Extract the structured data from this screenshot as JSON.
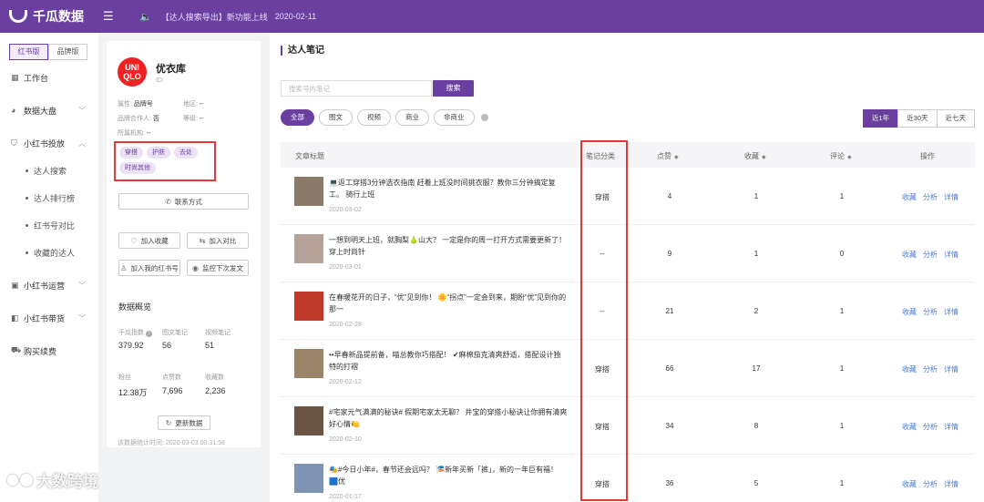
{
  "app": {
    "name": "千瓜数据",
    "notice": "【达人搜索导出】新功能上线",
    "notice_date": "2020-02-11"
  },
  "sidebar": {
    "version_tabs": [
      "红书版",
      "品牌版"
    ],
    "items": [
      {
        "label": "工作台"
      },
      {
        "label": "数据大盘"
      },
      {
        "label": "小红书投放"
      },
      {
        "label": "小红书运营"
      },
      {
        "label": "小红书带货"
      },
      {
        "label": "购买续费"
      }
    ],
    "sub_items": [
      "达人搜索",
      "达人排行榜",
      "红书号对比",
      "收藏的达人"
    ]
  },
  "profile": {
    "logo_text": "UNI QLO",
    "name": "优衣库",
    "id_label": "ID:",
    "attr_type_label": "属性:",
    "attr_type": "品牌号",
    "region_label": "地区:",
    "region": "--",
    "brand_coop_label": "品牌合作人:",
    "brand_coop": "否",
    "level_label": "等级:",
    "level": "--",
    "org_label": "所属机构:",
    "org": "--",
    "tags": [
      "穿搭",
      "护肤",
      "去处",
      "时尚其他"
    ],
    "contact_btn": "联系方式",
    "fav_btn": "加入收藏",
    "compare_btn": "加入对比",
    "mine_btn": "加入我的红书号",
    "monitor_btn": "监控下次发文",
    "overview_title": "数据概览",
    "stats": [
      {
        "label": "千瓜指数",
        "value": "379.92"
      },
      {
        "label": "图文笔记",
        "value": "56"
      },
      {
        "label": "视频笔记",
        "value": "51"
      },
      {
        "label": "粉丝",
        "value": "12.38万"
      },
      {
        "label": "点赞数",
        "value": "7,696"
      },
      {
        "label": "收藏数",
        "value": "2,236"
      }
    ],
    "update_btn": "更新数据",
    "update_time": "该数据统计时间: 2020-03-03 00:31:58"
  },
  "main": {
    "title": "达人笔记",
    "search_placeholder": "搜索号内笔记",
    "search_btn": "搜索",
    "filters": [
      "全部",
      "图文",
      "视频",
      "商业",
      "非商业"
    ],
    "periods": [
      "近1年",
      "近30天",
      "近七天"
    ],
    "columns": {
      "title": "文章标题",
      "category": "笔记分类",
      "likes": "点赞",
      "favs": "收藏",
      "comments": "评论",
      "ops": "操作"
    },
    "ops": [
      "收藏",
      "分析",
      "详情"
    ],
    "rows": [
      {
        "title": "💻返工穿搭3分钟选衣指南 赶着上班没时间挑衣服？教你三分钟搞定复工。 骑行上班",
        "date": "2020-03-02",
        "category": "穿搭",
        "likes": "4",
        "favs": "1",
        "comments": "1",
        "thumb": "#8a7a6a"
      },
      {
        "title": "一想到明天上班，就胸梨🍐山大？ 一定是你的周一打开方式需要更新了！穿上时尚针",
        "date": "2020-03-01",
        "category": "--",
        "likes": "9",
        "favs": "1",
        "comments": "0",
        "thumb": "#b5a39a"
      },
      {
        "title": "在春暖花开的日子，“优”见到你！ 🌼“拐点”一定会到来，期盼“优”见到你的那一",
        "date": "2020-02-28",
        "category": "--",
        "likes": "21",
        "favs": "2",
        "comments": "1",
        "thumb": "#c0392b"
      },
      {
        "title": "••早春新品提前备，喵总教你巧搭配！ ✔麻棉茄克清爽舒适，搭配设计独特的打褶",
        "date": "2020-02-12",
        "category": "穿搭",
        "likes": "66",
        "favs": "17",
        "comments": "1",
        "thumb": "#9c8468"
      },
      {
        "title": "#宅家元气满满的秘诀# 假期宅家太无聊？ 井宝的穿搭小秘诀让你拥有清爽好心情🍋",
        "date": "2020-02-10",
        "category": "穿搭",
        "likes": "34",
        "favs": "8",
        "comments": "1",
        "thumb": "#6b5443"
      },
      {
        "title": "🎭#今日小年#，春节还会远吗？ 🎏新年买新「裤」，新的一年巨有福！ 🟦优",
        "date": "2020-01-17",
        "category": "穿搭",
        "likes": "36",
        "favs": "5",
        "comments": "1",
        "thumb": "#7f93b5"
      }
    ]
  },
  "watermark": "大数跨境"
}
